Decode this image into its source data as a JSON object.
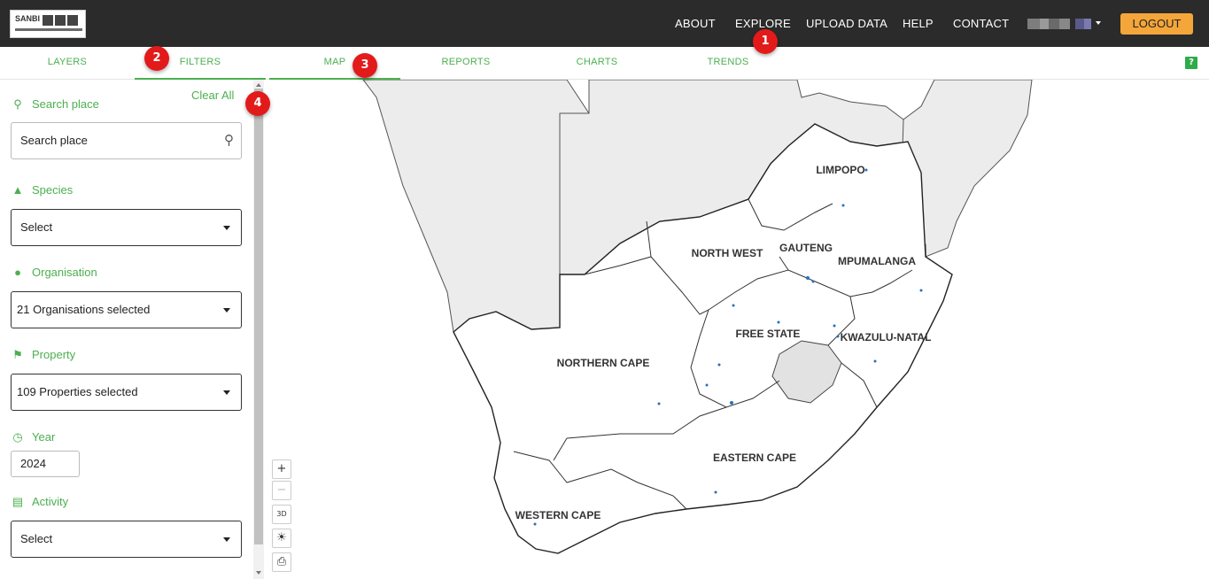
{
  "header": {
    "logo_text": "SANBI",
    "nav": [
      "ABOUT",
      "EXPLORE",
      "UPLOAD DATA",
      "HELP",
      "CONTACT"
    ],
    "logout_label": "LOGOUT"
  },
  "left_tabs": [
    "LAYERS",
    "FILTERS"
  ],
  "main_tabs": [
    "MAP",
    "REPORTS",
    "CHARTS",
    "TRENDS"
  ],
  "help_icon_text": "?",
  "markers": [
    "1",
    "2",
    "3",
    "4"
  ],
  "filters": {
    "clear_all": "Clear All",
    "search": {
      "label": "Search place",
      "placeholder": "Search place"
    },
    "species": {
      "label": "Species",
      "value": "Select"
    },
    "organisation": {
      "label": "Organisation",
      "value": "21 Organisations selected"
    },
    "property": {
      "label": "Property",
      "value": "109 Properties selected"
    },
    "year": {
      "label": "Year",
      "value": "2024"
    },
    "activity": {
      "label": "Activity",
      "value": "Select"
    }
  },
  "map": {
    "provinces": [
      "LIMPOPO",
      "NORTH WEST",
      "GAUTENG",
      "MPUMALANGA",
      "FREE STATE",
      "KWAZULU-NATAL",
      "NORTHERN CAPE",
      "EASTERN CAPE",
      "WESTERN CAPE"
    ],
    "controls": {
      "zoom_in": "+",
      "zoom_out": "−",
      "three_d": "3D"
    }
  },
  "colors": {
    "accent": "#4caf50",
    "logout": "#f4a63a",
    "marker": "#e31a1a",
    "topbar": "#2b2b2b"
  }
}
